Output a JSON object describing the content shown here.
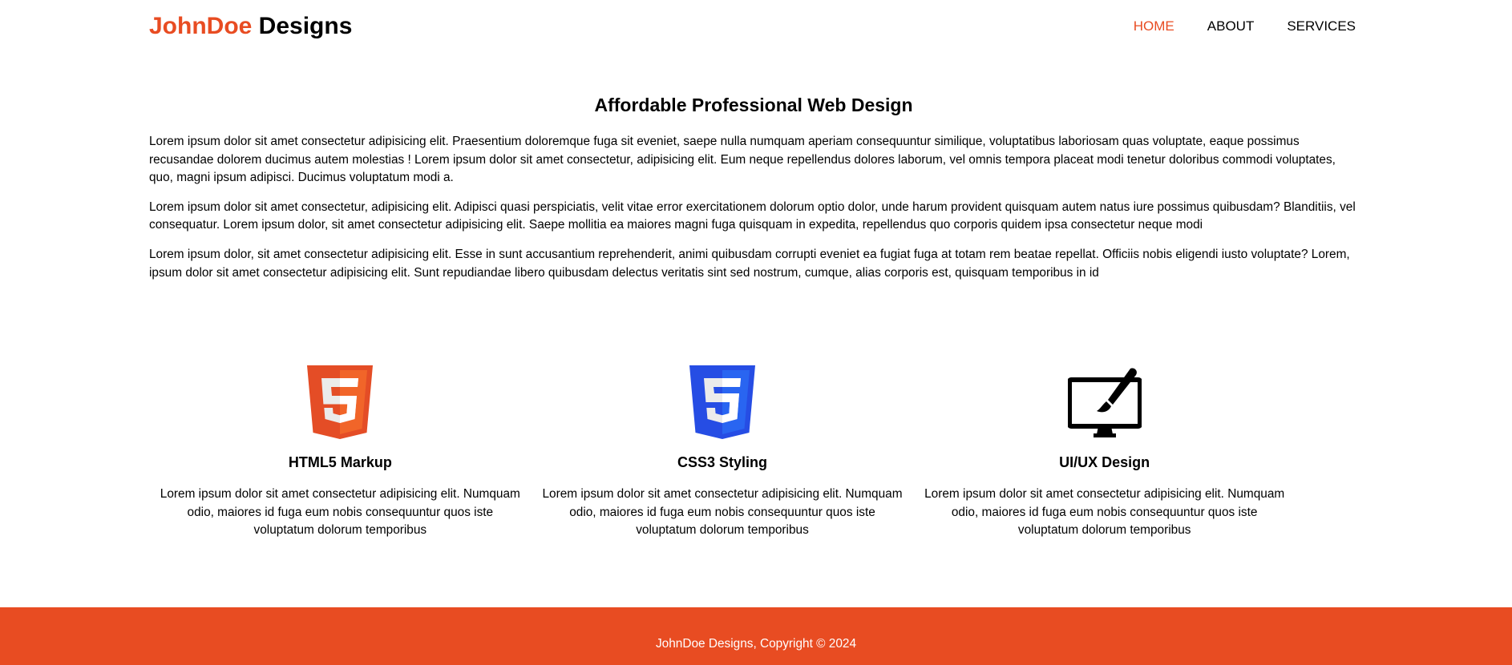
{
  "header": {
    "logo_accent": "JohnDoe",
    "logo_rest": " Designs",
    "nav": [
      {
        "label": "HOME",
        "active": true
      },
      {
        "label": "ABOUT",
        "active": false
      },
      {
        "label": "SERVICES",
        "active": false
      }
    ]
  },
  "intro": {
    "title": "Affordable Professional Web Design",
    "paragraphs": [
      "Lorem ipsum dolor sit amet consectetur adipisicing elit. Praesentium doloremque fuga sit eveniet, saepe nulla numquam aperiam consequuntur similique, voluptatibus laboriosam quas voluptate, eaque possimus recusandae dolorem ducimus autem molestias ! Lorem ipsum dolor sit amet consectetur, adipisicing elit. Eum neque repellendus dolores laborum, vel omnis tempora placeat modi tenetur doloribus commodi voluptates, quo, magni ipsum adipisci. Ducimus voluptatum modi a.",
      "Lorem ipsum dolor sit amet consectetur, adipisicing elit. Adipisci quasi perspiciatis, velit vitae error exercitationem dolorum optio dolor, unde harum provident quisquam autem natus iure possimus quibusdam? Blanditiis, vel consequatur. Lorem ipsum dolor, sit amet consectetur adipisicing elit. Saepe mollitia ea maiores magni fuga quisquam in expedita, repellendus quo corporis quidem ipsa consectetur neque modi",
      "Lorem ipsum dolor, sit amet consectetur adipisicing elit. Esse in sunt accusantium reprehenderit, animi quibusdam corrupti eveniet ea fugiat fuga at totam rem beatae repellat. Officiis nobis eligendi iusto voluptate? Lorem, ipsum dolor sit amet consectetur adipisicing elit. Sunt repudiandae libero quibusdam delectus veritatis sint sed nostrum, cumque, alias corporis est, quisquam temporibus in id"
    ]
  },
  "features": [
    {
      "icon": "html5-icon",
      "title": "HTML5 Markup",
      "text": "Lorem ipsum dolor sit amet consectetur adipisicing elit. Numquam odio, maiores id fuga eum nobis consequuntur quos iste voluptatum dolorum temporibus"
    },
    {
      "icon": "css3-icon",
      "title": "CSS3 Styling",
      "text": "Lorem ipsum dolor sit amet consectetur adipisicing elit. Numquam odio, maiores id fuga eum nobis consequuntur quos iste voluptatum dolorum temporibus"
    },
    {
      "icon": "monitor-brush-icon",
      "title": "UI/UX Design",
      "text": "Lorem ipsum dolor sit amet consectetur adipisicing elit. Numquam odio, maiores id fuga eum nobis consequuntur quos iste voluptatum dolorum temporibus"
    }
  ],
  "footer": {
    "text": "JohnDoe Designs, Copyright © 2024"
  },
  "colors": {
    "accent": "#e84c22",
    "html5_red": "#e44d26",
    "html5_orange": "#f16529",
    "css3_blue": "#264de4",
    "css3_light": "#2965f1"
  }
}
